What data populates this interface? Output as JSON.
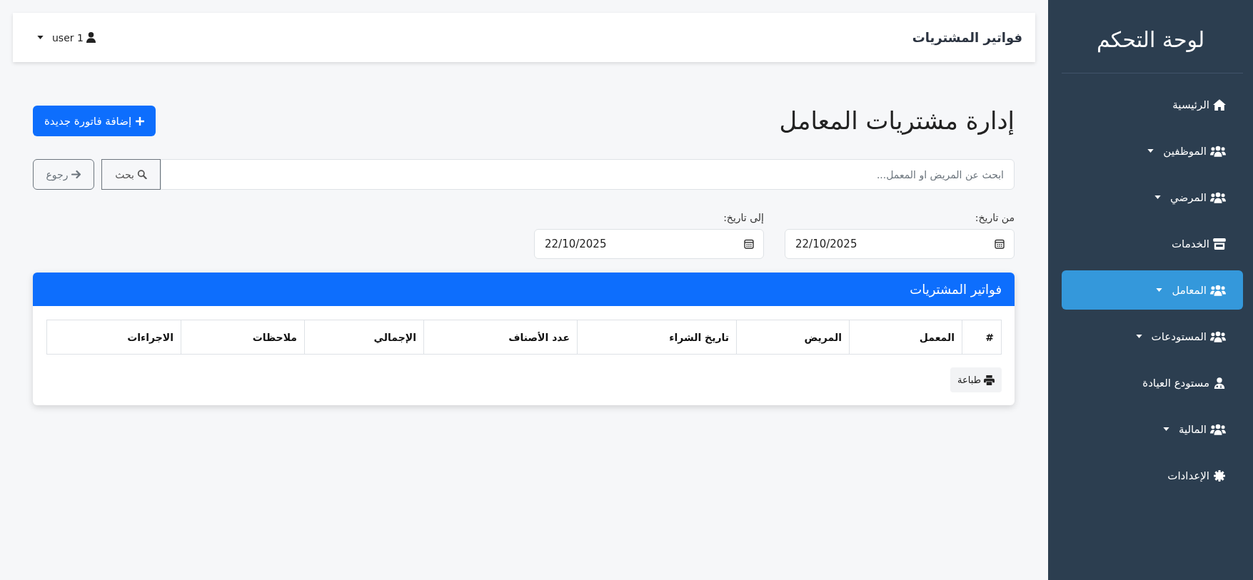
{
  "sidebar": {
    "title": "لوحة التحكم",
    "items": [
      {
        "label": "الرئيسية",
        "dropdown": false,
        "selected": false
      },
      {
        "label": "الموظفين",
        "dropdown": true,
        "selected": false
      },
      {
        "label": "المرضي",
        "dropdown": true,
        "selected": false
      },
      {
        "label": "الخدمات",
        "dropdown": false,
        "selected": false
      },
      {
        "label": "المعامل",
        "dropdown": true,
        "selected": true
      },
      {
        "label": "المستودعات",
        "dropdown": true,
        "selected": false
      },
      {
        "label": "مستودع العيادة",
        "dropdown": false,
        "selected": false
      },
      {
        "label": "المالية",
        "dropdown": true,
        "selected": false
      },
      {
        "label": "الإعدادات",
        "dropdown": false,
        "selected": false
      }
    ]
  },
  "top_bar": {
    "title": "فواتير المشتريات",
    "user": "user 1"
  },
  "page": {
    "heading": "إدارة مشتريات المعامل",
    "add_button": "إضافة فاتورة جديدة"
  },
  "search": {
    "placeholder": "ابحث عن المريض او المعمل...",
    "search_button": "بحث",
    "back_button": "رجوع"
  },
  "date_filters": [
    {
      "label": "من تاريخ:",
      "value": "22/10/2025"
    },
    {
      "label": "إلى تاريخ:",
      "value": "22/10/2025"
    }
  ],
  "card": {
    "title": "فواتير المشتريات",
    "table": {
      "columns": [
        "#",
        "المعمل",
        "المريض",
        "تاريخ الشراء",
        "عدد الأصناف",
        "الإجمالي",
        "ملاحظات",
        "الاجراءات"
      ]
    },
    "print_button": "طباعة"
  }
}
